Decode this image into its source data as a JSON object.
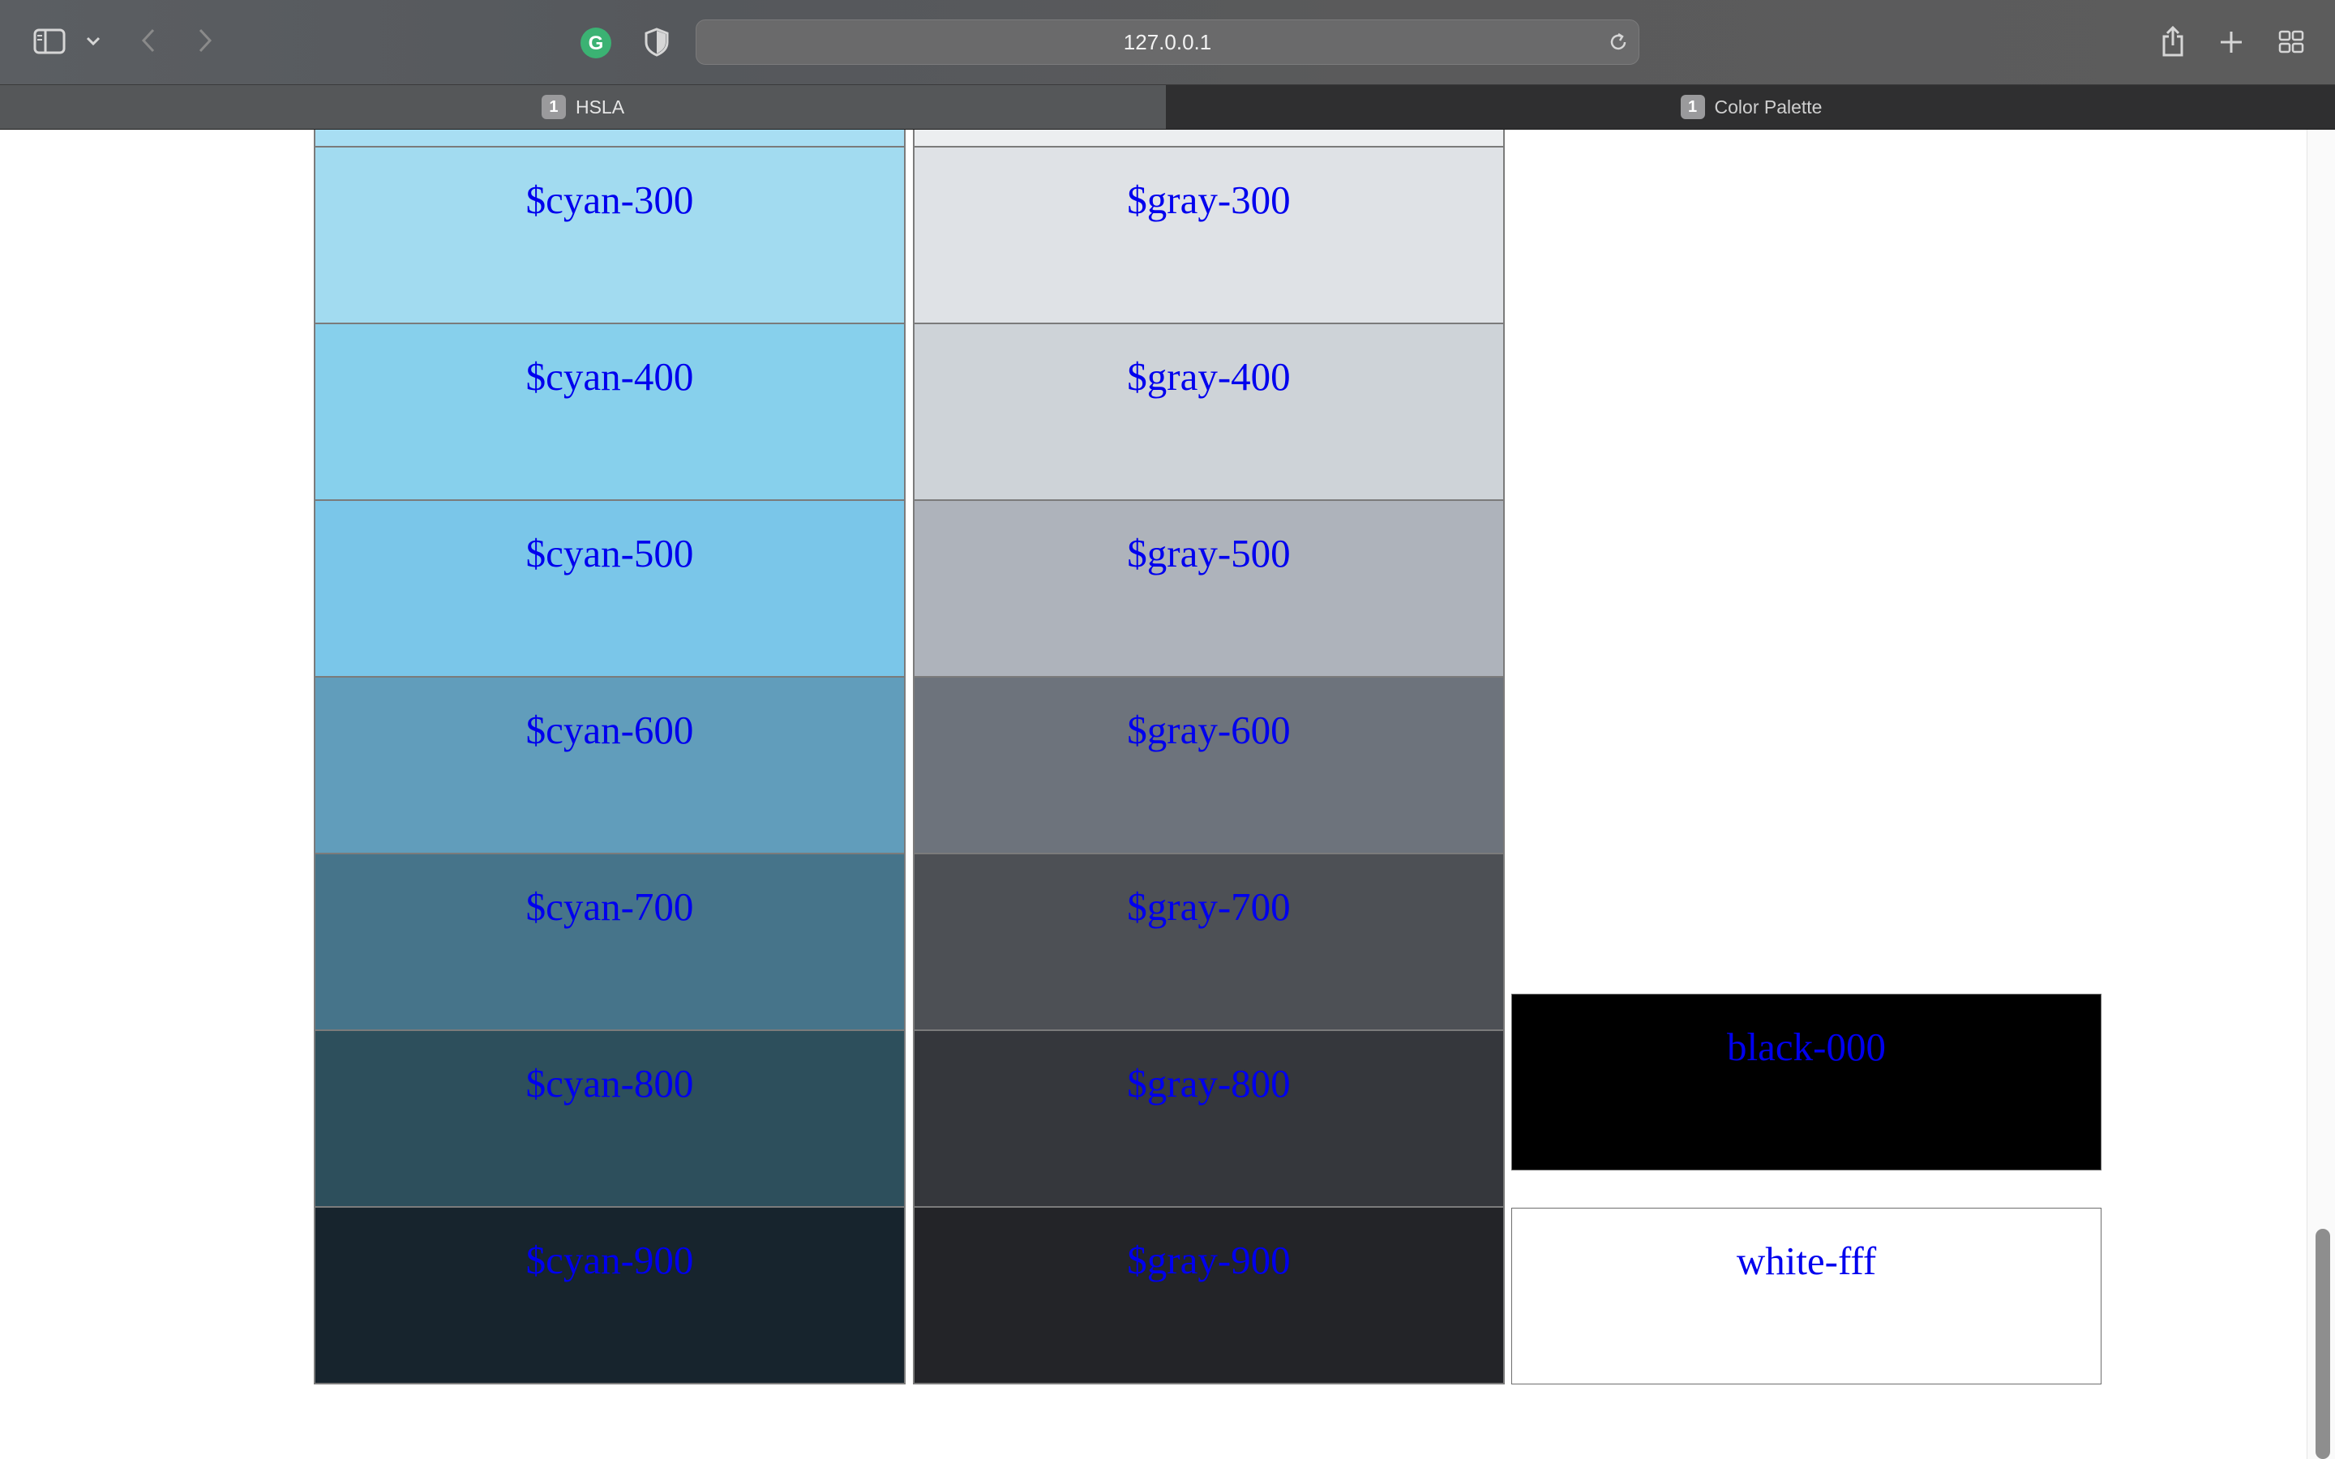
{
  "browser": {
    "url": "127.0.0.1",
    "tabs": [
      {
        "count": "1",
        "label": "HSLA",
        "active": true
      },
      {
        "count": "1",
        "label": "Color Palette",
        "active": false
      }
    ],
    "icons": [
      "sidebar-icon",
      "chevron-down-icon",
      "back-icon",
      "forward-icon",
      "grammarly-icon",
      "shield-icon",
      "reload-icon",
      "share-icon",
      "new-tab-icon",
      "tab-overview-icon"
    ]
  },
  "palette": {
    "cyan": [
      {
        "name": "$cyan-300",
        "color": "#a2dbf0"
      },
      {
        "name": "$cyan-400",
        "color": "#87d0ec"
      },
      {
        "name": "$cyan-500",
        "color": "#7ac6e9"
      },
      {
        "name": "$cyan-600",
        "color": "#619dbb"
      },
      {
        "name": "$cyan-700",
        "color": "#46748a"
      },
      {
        "name": "$cyan-800",
        "color": "#2d4f5c"
      },
      {
        "name": "$cyan-900",
        "color": "#17242d"
      }
    ],
    "gray": [
      {
        "name": "$gray-300",
        "color": "#dfe2e6"
      },
      {
        "name": "$gray-400",
        "color": "#ced3d8"
      },
      {
        "name": "$gray-500",
        "color": "#aeb3bb"
      },
      {
        "name": "$gray-600",
        "color": "#6d737c"
      },
      {
        "name": "$gray-700",
        "color": "#4d5055"
      },
      {
        "name": "$gray-800",
        "color": "#35373c"
      },
      {
        "name": "$gray-900",
        "color": "#232428"
      }
    ],
    "mono": [
      {
        "name": "black-000",
        "color": "#000000"
      },
      {
        "name": "white-fff",
        "color": "#ffffff"
      }
    ],
    "partial_top": {
      "cyan_color": "#a8def3",
      "gray_color": "#eceef0"
    },
    "label_color": "#0000ee"
  }
}
